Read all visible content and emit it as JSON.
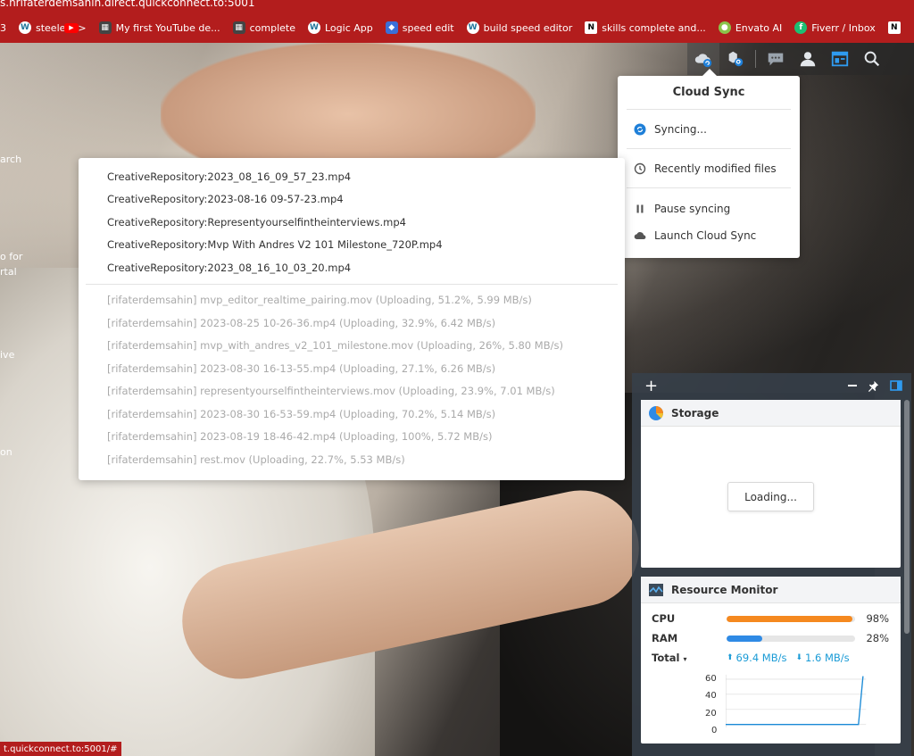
{
  "browser": {
    "url_fragment": "s.hrifaterdemsahin.direct.quickconnect.to:5001",
    "bookmarks": [
      {
        "icon": "wordpress-icon",
        "label": "steele"
      },
      {
        "icon": "youtube-icon",
        "label": ">"
      },
      {
        "icon": "clapperboard-icon",
        "label": "My first YouTube de..."
      },
      {
        "icon": "clapperboard-icon",
        "label": "complete"
      },
      {
        "icon": "wordpress-icon",
        "label": "Logic App"
      },
      {
        "icon": "app-icon",
        "label": "speed edit"
      },
      {
        "icon": "wordpress-icon",
        "label": "build speed editor"
      },
      {
        "icon": "notion-icon",
        "label": "skills complete and..."
      },
      {
        "icon": "envato-icon",
        "label": "Envato AI"
      },
      {
        "icon": "fiverr-icon",
        "label": "Fiverr / Inbox"
      },
      {
        "icon": "notion-icon",
        "label": ""
      }
    ],
    "bookmark_prefix": "3",
    "more": "»",
    "status_url": "t.quickconnect.to:5001/#"
  },
  "desktop_labels": [
    "arch",
    "o for",
    "rtal",
    "ive",
    "on"
  ],
  "cloud_sync": {
    "title": "Cloud Sync",
    "syncing": "Syncing...",
    "recent": "Recently modified files",
    "pause": "Pause syncing",
    "launch": "Launch Cloud Sync"
  },
  "files": {
    "completed": [
      "CreativeRepository:2023_08_16_09_57_23.mp4",
      "CreativeRepository:2023-08-16 09-57-23.mp4",
      "CreativeRepository:Representyourselfintheinterviews.mp4",
      "CreativeRepository:Mvp With Andres V2 101 Milestone_720P.mp4",
      "CreativeRepository:2023_08_16_10_03_20.mp4"
    ],
    "uploading": [
      "[rifaterdemsahin] mvp_editor_realtime_pairing.mov (Uploading, 51.2%, 5.99 MB/s)",
      "[rifaterdemsahin] 2023-08-25 10-26-36.mp4 (Uploading, 32.9%, 6.42 MB/s)",
      "[rifaterdemsahin] mvp_with_andres_v2_101_milestone.mov (Uploading, 26%, 5.80 MB/s)",
      "[rifaterdemsahin] 2023-08-30 16-13-55.mp4 (Uploading, 27.1%, 6.26 MB/s)",
      "[rifaterdemsahin] representyourselfintheinterviews.mov (Uploading, 23.9%, 7.01 MB/s)",
      "[rifaterdemsahin] 2023-08-30 16-53-59.mp4 (Uploading, 70.2%, 5.14 MB/s)",
      "[rifaterdemsahin] 2023-08-19 18-46-42.mp4 (Uploading, 100%, 5.72 MB/s)",
      "[rifaterdemsahin] rest.mov (Uploading, 22.7%, 5.53 MB/s)"
    ]
  },
  "widgets": {
    "add": "+",
    "storage": {
      "title": "Storage",
      "loading": "Loading..."
    },
    "resource_monitor": {
      "title": "Resource Monitor",
      "cpu_label": "CPU",
      "cpu_pct": "98%",
      "cpu_value": 98,
      "ram_label": "RAM",
      "ram_pct": "28%",
      "ram_value": 28,
      "total_label": "Total",
      "upload": "69.4 MB/s",
      "download": "1.6 MB/s",
      "y_ticks": [
        "60",
        "40",
        "20",
        "0"
      ],
      "cpu_color": "#f5891f",
      "ram_color": "#2f8ae5",
      "net_color": "#1a9bd6"
    }
  }
}
